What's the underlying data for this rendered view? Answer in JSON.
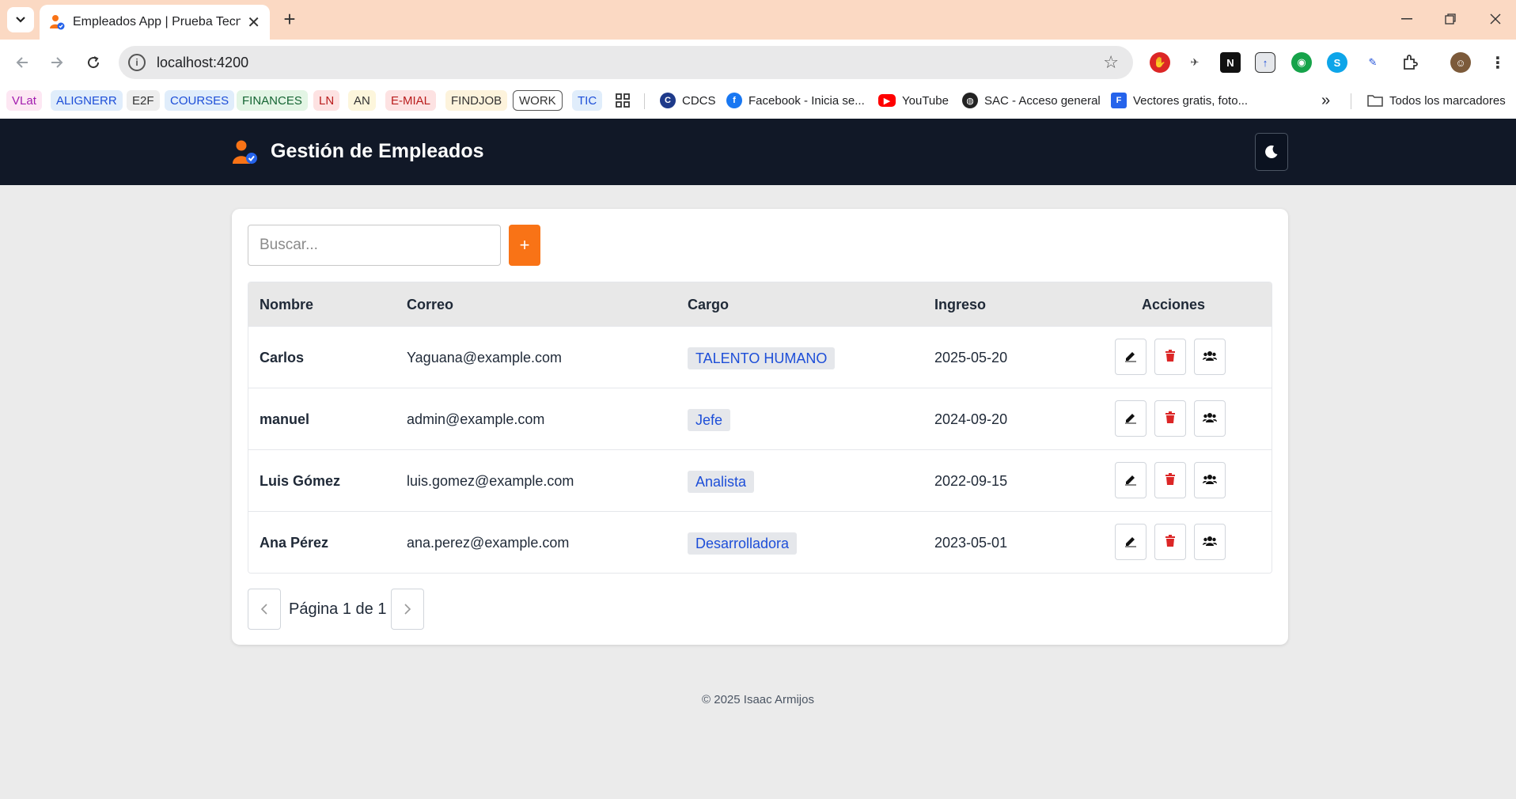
{
  "browser": {
    "tab_title": "Empleados App | Prueba Tecnica",
    "url": "localhost:4200",
    "bookmarks": [
      {
        "label": "VLat",
        "bg": "#fde7f3",
        "fg": "#a21caf"
      },
      {
        "label": "ALIGNERR",
        "bg": "#e0edfb",
        "fg": "#1d4ed8"
      },
      {
        "label": "E2F",
        "bg": "#eeeeee",
        "fg": "#333333"
      },
      {
        "label": "COURSES",
        "bg": "#e0edfb",
        "fg": "#1d4ed8"
      },
      {
        "label": "FINANCES",
        "bg": "#e3f5e5",
        "fg": "#166534"
      },
      {
        "label": "LN",
        "bg": "#fde2e2",
        "fg": "#b91c1c"
      },
      {
        "label": "AN",
        "bg": "#fdf6dc",
        "fg": "#333333"
      },
      {
        "label": "E-MIAL",
        "bg": "#fde2e2",
        "fg": "#b91c1c"
      },
      {
        "label": "FINDJOB",
        "bg": "#fdf3dc",
        "fg": "#333333"
      },
      {
        "label": "WORK",
        "bg": "#ffffff",
        "fg": "#333333"
      },
      {
        "label": "TIC",
        "bg": "#e0edfb",
        "fg": "#1d4ed8"
      }
    ],
    "bookmark_links": [
      {
        "label": "CDCS"
      },
      {
        "label": "Facebook - Inicia se..."
      },
      {
        "label": "YouTube"
      },
      {
        "label": "SAC - Acceso general"
      },
      {
        "label": "Vectores gratis, foto..."
      }
    ],
    "all_bookmarks_label": "Todos los marcadores"
  },
  "app": {
    "title": "Gestión de Empleados",
    "search_placeholder": "Buscar...",
    "add_label": "+",
    "columns": {
      "nombre": "Nombre",
      "correo": "Correo",
      "cargo": "Cargo",
      "ingreso": "Ingreso",
      "acciones": "Acciones"
    },
    "employees": [
      {
        "nombre": "Carlos",
        "correo": "Yaguana@example.com",
        "cargo": "TALENTO HUMANO",
        "ingreso": "2025-05-20"
      },
      {
        "nombre": "manuel",
        "correo": "admin@example.com",
        "cargo": "Jefe",
        "ingreso": "2024-09-20"
      },
      {
        "nombre": "Luis Gómez",
        "correo": "luis.gomez@example.com",
        "cargo": "Analista",
        "ingreso": "2022-09-15"
      },
      {
        "nombre": "Ana Pérez",
        "correo": "ana.perez@example.com",
        "cargo": "Desarrolladora",
        "ingreso": "2023-05-01"
      }
    ],
    "pagination": {
      "text": "Página 1 de 1",
      "prev_icon": "chevron-left-icon",
      "next_icon": "chevron-right-icon"
    },
    "footer": "© 2025 Isaac Armijos",
    "colors": {
      "header_bg": "#111827",
      "accent": "#f97316",
      "delete": "#dc2626",
      "badge_text": "#1d4ed8"
    }
  }
}
